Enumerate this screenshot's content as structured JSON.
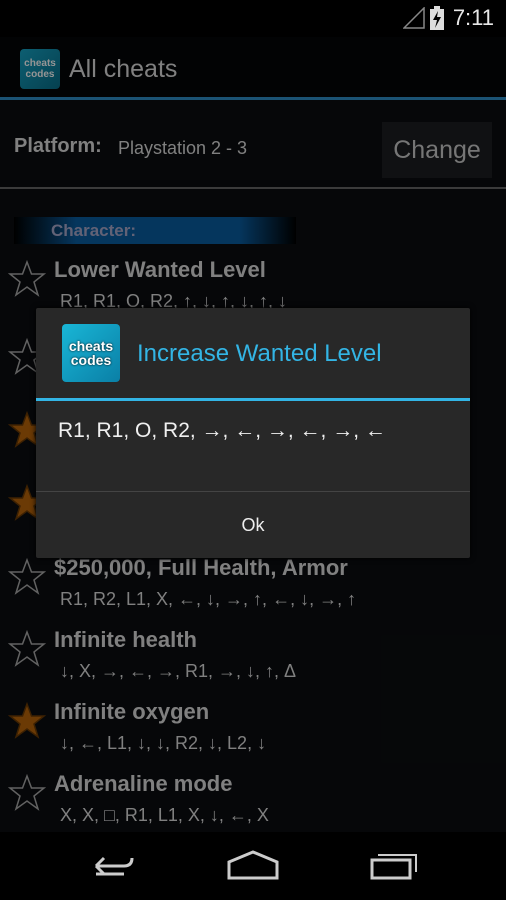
{
  "status_bar": {
    "time": "7:11",
    "icons": [
      "signal-icon",
      "battery-charging-icon"
    ]
  },
  "action_bar": {
    "title": "All cheats",
    "logo_text": "cheats codes"
  },
  "platform": {
    "label": "Platform:",
    "value": "Playstation 2 - 3",
    "change_label": "Change"
  },
  "category": {
    "label": "Character:"
  },
  "colors": {
    "accent": "#33b5e5",
    "star_filled": "#b8650a"
  },
  "cheats": [
    {
      "title": "Lower Wanted Level",
      "code": "R1, R1, O, R2, ↑, ↓, ↑, ↓, ↑, ↓",
      "favorite": false
    },
    {
      "title": "",
      "code": "",
      "favorite": false
    },
    {
      "title": "",
      "code": "",
      "favorite": true
    },
    {
      "title": "",
      "code": "",
      "favorite": true
    },
    {
      "title": "$250,000, Full Health, Armor",
      "code": "R1, R2, L1, X, ←, ↓, →, ↑, ←, ↓, →, ↑",
      "favorite": false
    },
    {
      "title": "Infinite health",
      "code": "↓, X, →, ←, →, R1, →, ↓, ↑, Δ",
      "favorite": false
    },
    {
      "title": "Infinite oxygen",
      "code": "↓, ←, L1, ↓, ↓, R2, ↓, L2, ↓",
      "favorite": true
    },
    {
      "title": "Adrenaline mode",
      "code": "X, X, □, R1, L1, X, ↓, ←, X",
      "favorite": false
    }
  ],
  "dialog": {
    "title": "Increase Wanted Level",
    "code": "R1, R1, O, R2, →, ←, →, ←, →, ←",
    "ok_label": "Ok",
    "logo_text": "cheats codes"
  },
  "nav": {
    "icons": [
      "back-icon",
      "home-icon",
      "recent-apps-icon"
    ]
  }
}
